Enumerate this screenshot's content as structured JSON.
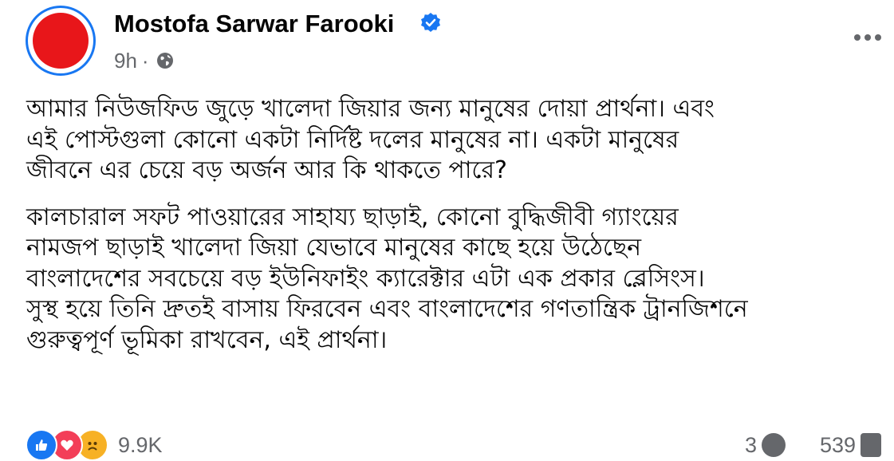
{
  "author": {
    "name": "Mostofa Sarwar Farooki",
    "verified": true
  },
  "meta": {
    "time": "9h",
    "separator": "·",
    "audience_icon": "globe-icon"
  },
  "post": {
    "paragraphs": [
      [
        "আমার নিউজফিড জুড়ে খালেদা জিয়ার জন্য মানুষের দোয়া প্রার্থনা। এবং",
        "এই পোস্টগুলা কোনো একটা নির্দিষ্ট দলের মানুষের না। একটা মানুষের",
        "জীবনে এর চেয়ে বড় অর্জন আর কি থাকতে পারে?"
      ],
      [
        "কালচারাল সফট পাওয়ারের সাহায্য ছাড়াই, কোনো বুদ্ধিজীবী গ্যাংয়ের",
        "নামজপ ছাড়াই খালেদা জিয়া যেভাবে মানুষের কাছে হয়ে উঠেছেন",
        "বাংলাদেশের সবচেয়ে বড় ইউনিফাইং ক্যারেক্টার এটা এক প্রকার ব্লেসিংস।",
        "সুস্থ হয়ে তিনি দ্রুতই বাসায় ফিরবেন এবং বাংলাদেশের গণতান্ত্রিক ট্রানজিশনে",
        "গুরুত্বপূর্ণ ভূমিকা রাখবেন, এই প্রার্থনা।"
      ]
    ]
  },
  "reactions": {
    "types": [
      "like",
      "love",
      "sad"
    ],
    "count": "9.9K"
  },
  "stats": {
    "comments": "3",
    "shares": "539"
  },
  "colors": {
    "accent": "#1877f2",
    "avatar": "#e8161a",
    "muted": "#65676b"
  }
}
